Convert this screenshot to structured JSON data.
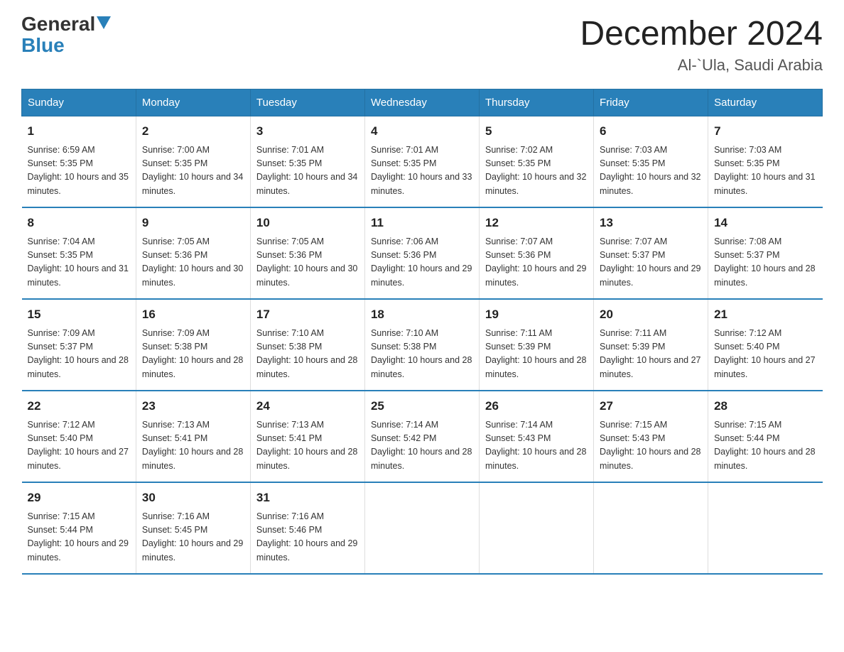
{
  "header": {
    "logo_general": "General",
    "logo_blue": "Blue",
    "month_title": "December 2024",
    "location": "Al-`Ula, Saudi Arabia"
  },
  "weekdays": [
    "Sunday",
    "Monday",
    "Tuesday",
    "Wednesday",
    "Thursday",
    "Friday",
    "Saturday"
  ],
  "weeks": [
    [
      {
        "day": "1",
        "sunrise": "6:59 AM",
        "sunset": "5:35 PM",
        "daylight": "10 hours and 35 minutes."
      },
      {
        "day": "2",
        "sunrise": "7:00 AM",
        "sunset": "5:35 PM",
        "daylight": "10 hours and 34 minutes."
      },
      {
        "day": "3",
        "sunrise": "7:01 AM",
        "sunset": "5:35 PM",
        "daylight": "10 hours and 34 minutes."
      },
      {
        "day": "4",
        "sunrise": "7:01 AM",
        "sunset": "5:35 PM",
        "daylight": "10 hours and 33 minutes."
      },
      {
        "day": "5",
        "sunrise": "7:02 AM",
        "sunset": "5:35 PM",
        "daylight": "10 hours and 32 minutes."
      },
      {
        "day": "6",
        "sunrise": "7:03 AM",
        "sunset": "5:35 PM",
        "daylight": "10 hours and 32 minutes."
      },
      {
        "day": "7",
        "sunrise": "7:03 AM",
        "sunset": "5:35 PM",
        "daylight": "10 hours and 31 minutes."
      }
    ],
    [
      {
        "day": "8",
        "sunrise": "7:04 AM",
        "sunset": "5:35 PM",
        "daylight": "10 hours and 31 minutes."
      },
      {
        "day": "9",
        "sunrise": "7:05 AM",
        "sunset": "5:36 PM",
        "daylight": "10 hours and 30 minutes."
      },
      {
        "day": "10",
        "sunrise": "7:05 AM",
        "sunset": "5:36 PM",
        "daylight": "10 hours and 30 minutes."
      },
      {
        "day": "11",
        "sunrise": "7:06 AM",
        "sunset": "5:36 PM",
        "daylight": "10 hours and 29 minutes."
      },
      {
        "day": "12",
        "sunrise": "7:07 AM",
        "sunset": "5:36 PM",
        "daylight": "10 hours and 29 minutes."
      },
      {
        "day": "13",
        "sunrise": "7:07 AM",
        "sunset": "5:37 PM",
        "daylight": "10 hours and 29 minutes."
      },
      {
        "day": "14",
        "sunrise": "7:08 AM",
        "sunset": "5:37 PM",
        "daylight": "10 hours and 28 minutes."
      }
    ],
    [
      {
        "day": "15",
        "sunrise": "7:09 AM",
        "sunset": "5:37 PM",
        "daylight": "10 hours and 28 minutes."
      },
      {
        "day": "16",
        "sunrise": "7:09 AM",
        "sunset": "5:38 PM",
        "daylight": "10 hours and 28 minutes."
      },
      {
        "day": "17",
        "sunrise": "7:10 AM",
        "sunset": "5:38 PM",
        "daylight": "10 hours and 28 minutes."
      },
      {
        "day": "18",
        "sunrise": "7:10 AM",
        "sunset": "5:38 PM",
        "daylight": "10 hours and 28 minutes."
      },
      {
        "day": "19",
        "sunrise": "7:11 AM",
        "sunset": "5:39 PM",
        "daylight": "10 hours and 28 minutes."
      },
      {
        "day": "20",
        "sunrise": "7:11 AM",
        "sunset": "5:39 PM",
        "daylight": "10 hours and 27 minutes."
      },
      {
        "day": "21",
        "sunrise": "7:12 AM",
        "sunset": "5:40 PM",
        "daylight": "10 hours and 27 minutes."
      }
    ],
    [
      {
        "day": "22",
        "sunrise": "7:12 AM",
        "sunset": "5:40 PM",
        "daylight": "10 hours and 27 minutes."
      },
      {
        "day": "23",
        "sunrise": "7:13 AM",
        "sunset": "5:41 PM",
        "daylight": "10 hours and 28 minutes."
      },
      {
        "day": "24",
        "sunrise": "7:13 AM",
        "sunset": "5:41 PM",
        "daylight": "10 hours and 28 minutes."
      },
      {
        "day": "25",
        "sunrise": "7:14 AM",
        "sunset": "5:42 PM",
        "daylight": "10 hours and 28 minutes."
      },
      {
        "day": "26",
        "sunrise": "7:14 AM",
        "sunset": "5:43 PM",
        "daylight": "10 hours and 28 minutes."
      },
      {
        "day": "27",
        "sunrise": "7:15 AM",
        "sunset": "5:43 PM",
        "daylight": "10 hours and 28 minutes."
      },
      {
        "day": "28",
        "sunrise": "7:15 AM",
        "sunset": "5:44 PM",
        "daylight": "10 hours and 28 minutes."
      }
    ],
    [
      {
        "day": "29",
        "sunrise": "7:15 AM",
        "sunset": "5:44 PM",
        "daylight": "10 hours and 29 minutes."
      },
      {
        "day": "30",
        "sunrise": "7:16 AM",
        "sunset": "5:45 PM",
        "daylight": "10 hours and 29 minutes."
      },
      {
        "day": "31",
        "sunrise": "7:16 AM",
        "sunset": "5:46 PM",
        "daylight": "10 hours and 29 minutes."
      },
      null,
      null,
      null,
      null
    ]
  ],
  "labels": {
    "sunrise": "Sunrise:",
    "sunset": "Sunset:",
    "daylight": "Daylight:"
  }
}
